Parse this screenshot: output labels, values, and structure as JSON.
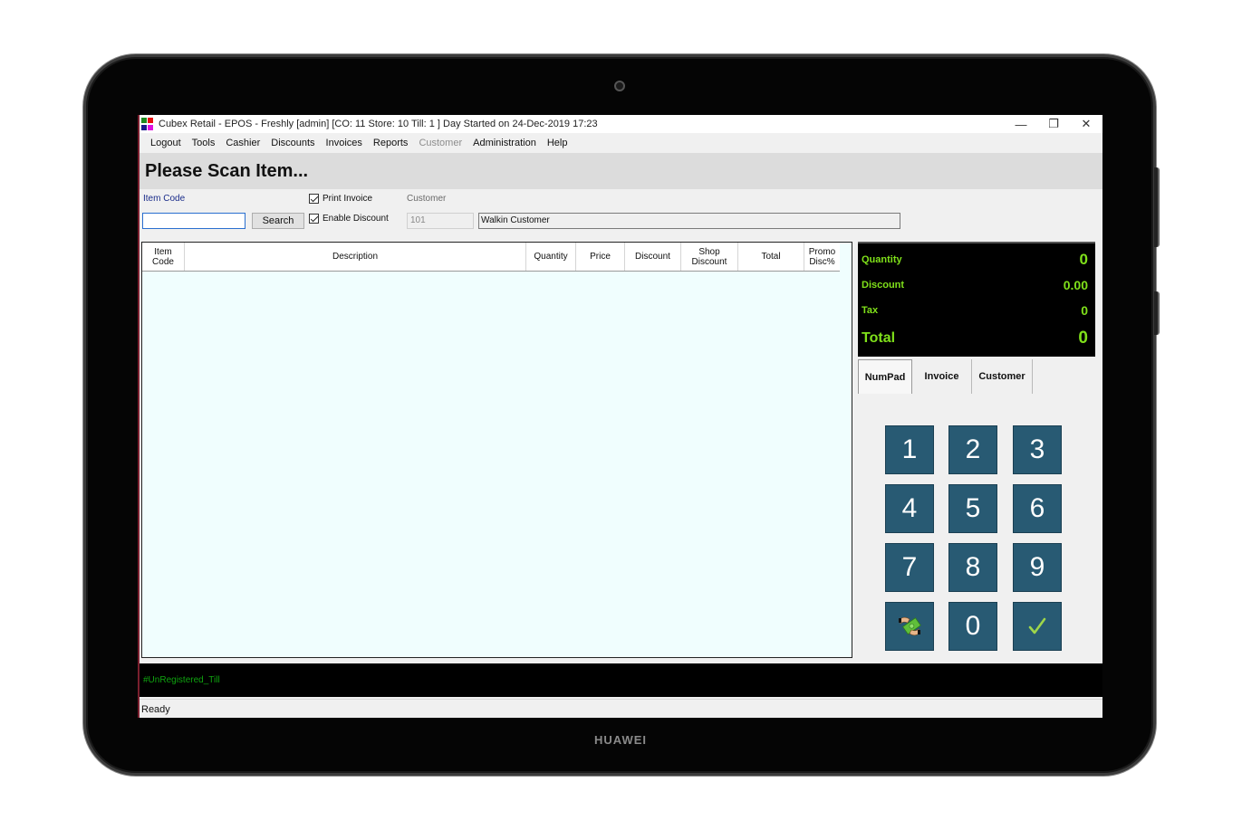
{
  "device": {
    "brand": "HUAWEI"
  },
  "window": {
    "title": "Cubex Retail - EPOS - Freshly [admin] [CO: 11 Store: 10 Till: 1 ] Day Started on 24-Dec-2019 17:23",
    "logo_colors": [
      "#1e8a1e",
      "#e81010",
      "#1a1a8c",
      "#e010e0"
    ],
    "controls": {
      "minimize": "—",
      "restore": "❐",
      "close": "✕"
    }
  },
  "menu": {
    "items": [
      {
        "label": "Logout",
        "enabled": true
      },
      {
        "label": "Tools",
        "enabled": true
      },
      {
        "label": "Cashier",
        "enabled": true
      },
      {
        "label": "Discounts",
        "enabled": true
      },
      {
        "label": "Invoices",
        "enabled": true
      },
      {
        "label": "Reports",
        "enabled": true
      },
      {
        "label": "Customer",
        "enabled": false
      },
      {
        "label": "Administration",
        "enabled": true
      },
      {
        "label": "Help",
        "enabled": true
      }
    ]
  },
  "banner": {
    "message": "Please Scan Item..."
  },
  "toolbar": {
    "item_code_label": "Item Code",
    "item_code_value": "",
    "search_label": "Search",
    "print_invoice_label": "Print Invoice",
    "print_invoice_checked": true,
    "enable_discount_label": "Enable Discount",
    "enable_discount_checked": true,
    "customer_label": "Customer",
    "customer_id": "101",
    "customer_name": "Walkin Customer"
  },
  "grid": {
    "columns": [
      {
        "key": "item_code",
        "label": "Item\nCode"
      },
      {
        "key": "description",
        "label": "Description"
      },
      {
        "key": "quantity",
        "label": "Quantity"
      },
      {
        "key": "price",
        "label": "Price"
      },
      {
        "key": "discount",
        "label": "Discount"
      },
      {
        "key": "shop_discount",
        "label": "Shop\nDiscount"
      },
      {
        "key": "total",
        "label": "Total"
      },
      {
        "key": "promo_disc",
        "label": "Promo\nDisc%"
      }
    ],
    "rows": []
  },
  "totals": {
    "quantity_label": "Quantity",
    "quantity_value": "0",
    "discount_label": "Discount",
    "discount_value": "0.00",
    "tax_label": "Tax",
    "tax_value": "0",
    "total_label": "Total",
    "total_value": "0",
    "text_color": "#7fe01a"
  },
  "tabs": [
    {
      "label": "NumPad",
      "active": true
    },
    {
      "label": "Invoice",
      "active": false
    },
    {
      "label": "Customer",
      "active": false
    }
  ],
  "numpad": {
    "keys": [
      "1",
      "2",
      "3",
      "4",
      "5",
      "6",
      "7",
      "8",
      "9",
      "cash-payment-icon",
      "0",
      "checkmark-icon"
    ],
    "key_color": "#285a73"
  },
  "till": {
    "status": "#UnRegistered_Till"
  },
  "statusbar": {
    "text": "Ready"
  }
}
